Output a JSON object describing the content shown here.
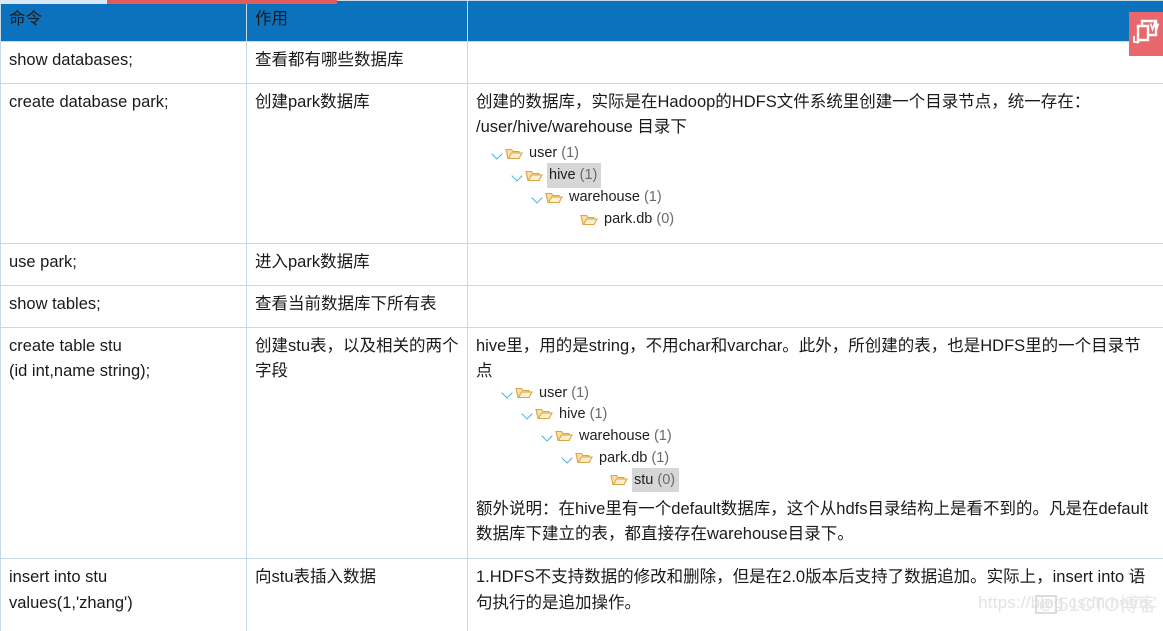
{
  "table": {
    "headers": [
      "命令",
      "作用",
      ""
    ],
    "rows": [
      {
        "command": "show  databases;",
        "effect": "查看都有哪些数据库",
        "note_paragraphs": [],
        "tree": null
      },
      {
        "command": "create database park;",
        "effect": "创建park数据库",
        "note_paragraphs": [
          "创建的数据库，实际是在Hadoop的HDFS文件系统里创建一个目录节点，统一存在： /user/hive/warehouse 目录下"
        ],
        "tree": {
          "nodes": [
            {
              "label": "user",
              "count": "(1)",
              "depth": 0,
              "expandable": true,
              "selected": false
            },
            {
              "label": "hive",
              "count": "(1)",
              "depth": 1,
              "expandable": true,
              "selected": true
            },
            {
              "label": "warehouse",
              "count": "(1)",
              "depth": 2,
              "expandable": true,
              "selected": false
            },
            {
              "label": "park.db",
              "count": "(0)",
              "depth": 3,
              "expandable": false,
              "selected": false
            }
          ]
        }
      },
      {
        "command": "use  park;",
        "effect": "进入park数据库",
        "note_paragraphs": [],
        "tree": null
      },
      {
        "command": "show tables;",
        "effect": "查看当前数据库下所有表",
        "note_paragraphs": [],
        "tree": null
      },
      {
        "command": "create table stu\n (id int,name string);",
        "effect": "创建stu表，以及相关的两个字段",
        "note_paragraphs": [
          "hive里，用的是string，不用char和varchar。此外，所创建的表，也是HDFS里的一个目录节点"
        ],
        "note_paragraphs_after": [
          "额外说明：在hive里有一个default数据库，这个从hdfs目录结构上是看不到的。凡是在default数据库下建立的表，都直接存在warehouse目录下。"
        ],
        "tree": {
          "nodes": [
            {
              "label": "user",
              "count": "(1)",
              "depth": 0,
              "expandable": true,
              "selected": false
            },
            {
              "label": "hive",
              "count": "(1)",
              "depth": 1,
              "expandable": true,
              "selected": false
            },
            {
              "label": "warehouse",
              "count": "(1)",
              "depth": 2,
              "expandable": true,
              "selected": false
            },
            {
              "label": "park.db",
              "count": "(1)",
              "depth": 3,
              "expandable": true,
              "selected": false
            },
            {
              "label": "stu",
              "count": "(0)",
              "depth": 4,
              "expandable": false,
              "selected": true
            }
          ]
        }
      },
      {
        "command": "insert into stu\nvalues(1,'zhang')",
        "effect": "向stu表插入数据",
        "note_paragraphs": [
          "1.HDFS不支持数据的修改和删除，但是在2.0版本后支持了数据追加。实际上，insert into 语句执行的是追加操作。"
        ],
        "tree": null
      }
    ]
  },
  "watermarks": {
    "url": "https://blog.csdn.net/q",
    "cto_badge": "@",
    "cto_text": "51CTO博客"
  },
  "colors": {
    "header_blue": "#0d72bd",
    "border": "#c6d9e8",
    "icon_red": "#e8676b",
    "top_strip_red": "#e05c5c",
    "tree_chevron": "#3fb6e0",
    "tree_selection": "#d6d6d6"
  },
  "icons": {
    "corner": "word-document-icon",
    "folder": "folder-icon",
    "chevron": "chevron-down-icon"
  }
}
